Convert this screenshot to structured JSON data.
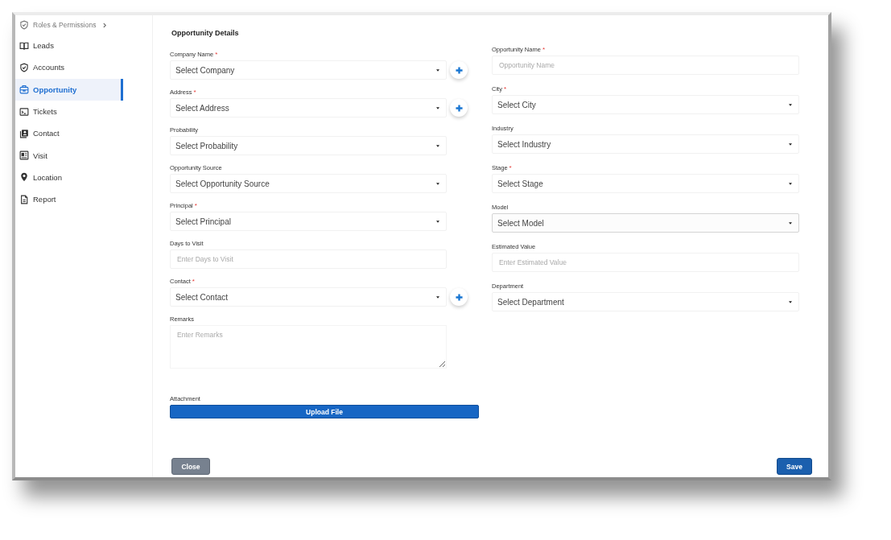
{
  "sidebar": {
    "items": [
      {
        "label": "Roles & Permissions",
        "kind": "group",
        "selected": false
      },
      {
        "label": "Leads",
        "kind": "link",
        "selected": false
      },
      {
        "label": "Accounts",
        "kind": "link",
        "selected": false
      },
      {
        "label": "Opportunity",
        "kind": "link",
        "selected": true
      },
      {
        "label": "Tickets",
        "kind": "link",
        "selected": false
      },
      {
        "label": "Contact",
        "kind": "link",
        "selected": false
      },
      {
        "label": "Visit",
        "kind": "link",
        "selected": false
      },
      {
        "label": "Location",
        "kind": "link",
        "selected": false
      },
      {
        "label": "Report",
        "kind": "link",
        "selected": false
      }
    ]
  },
  "form": {
    "title": "Opportunity Details",
    "left_fields": [
      {
        "label": "Company Name",
        "required_mark": "*",
        "kind": "select",
        "placeholder": "Select Company",
        "add_button": true,
        "focused": false
      },
      {
        "label": "Address",
        "required_mark": "*",
        "kind": "select",
        "placeholder": "Select Address",
        "add_button": true,
        "focused": false
      },
      {
        "label": "Probability",
        "kind": "select",
        "placeholder": "Select Probability",
        "add_button": false,
        "focused": false
      },
      {
        "label": "Opportunity Source",
        "kind": "select",
        "placeholder": "Select Opportunity Source",
        "add_button": false,
        "focused": false
      },
      {
        "label": "Principal",
        "required_mark": "*",
        "kind": "select",
        "placeholder": "Select Principal",
        "add_button": false,
        "focused": false
      },
      {
        "label": "Days to Visit",
        "kind": "input",
        "placeholder": "Enter Days to Visit",
        "add_button": false,
        "focused": false
      },
      {
        "label": "Contact",
        "required_mark": "*",
        "kind": "select",
        "placeholder": "Select Contact",
        "add_button": true,
        "focused": false
      },
      {
        "label": "Remarks",
        "kind": "textarea",
        "placeholder": "Enter Remarks",
        "add_button": false,
        "focused": false
      }
    ],
    "right_fields": [
      {
        "label": "Opportunity Name",
        "required_mark": "*",
        "kind": "input",
        "placeholder": "Opportunity Name",
        "add_button": false,
        "focused": false
      },
      {
        "label": "City",
        "required_mark": "*",
        "kind": "select",
        "placeholder": "Select City",
        "add_button": false,
        "focused": false
      },
      {
        "label": "Industry",
        "kind": "select",
        "placeholder": "Select Industry",
        "add_button": false,
        "focused": false
      },
      {
        "label": "Stage",
        "required_mark": "*",
        "kind": "select",
        "placeholder": "Select Stage",
        "add_button": false,
        "focused": false
      },
      {
        "label": "Model",
        "kind": "select",
        "placeholder": "Select Model",
        "add_button": false,
        "focused": true
      },
      {
        "label": "Estimated Value",
        "kind": "input",
        "placeholder": "Enter Estimated Value",
        "add_button": false,
        "focused": false
      },
      {
        "label": "Department",
        "kind": "select",
        "placeholder": "Select Department",
        "add_button": false,
        "focused": false
      }
    ],
    "attachment": {
      "label": "Attachment",
      "button": "Upload File"
    }
  },
  "footer": {
    "close": "Close",
    "save": "Save"
  }
}
